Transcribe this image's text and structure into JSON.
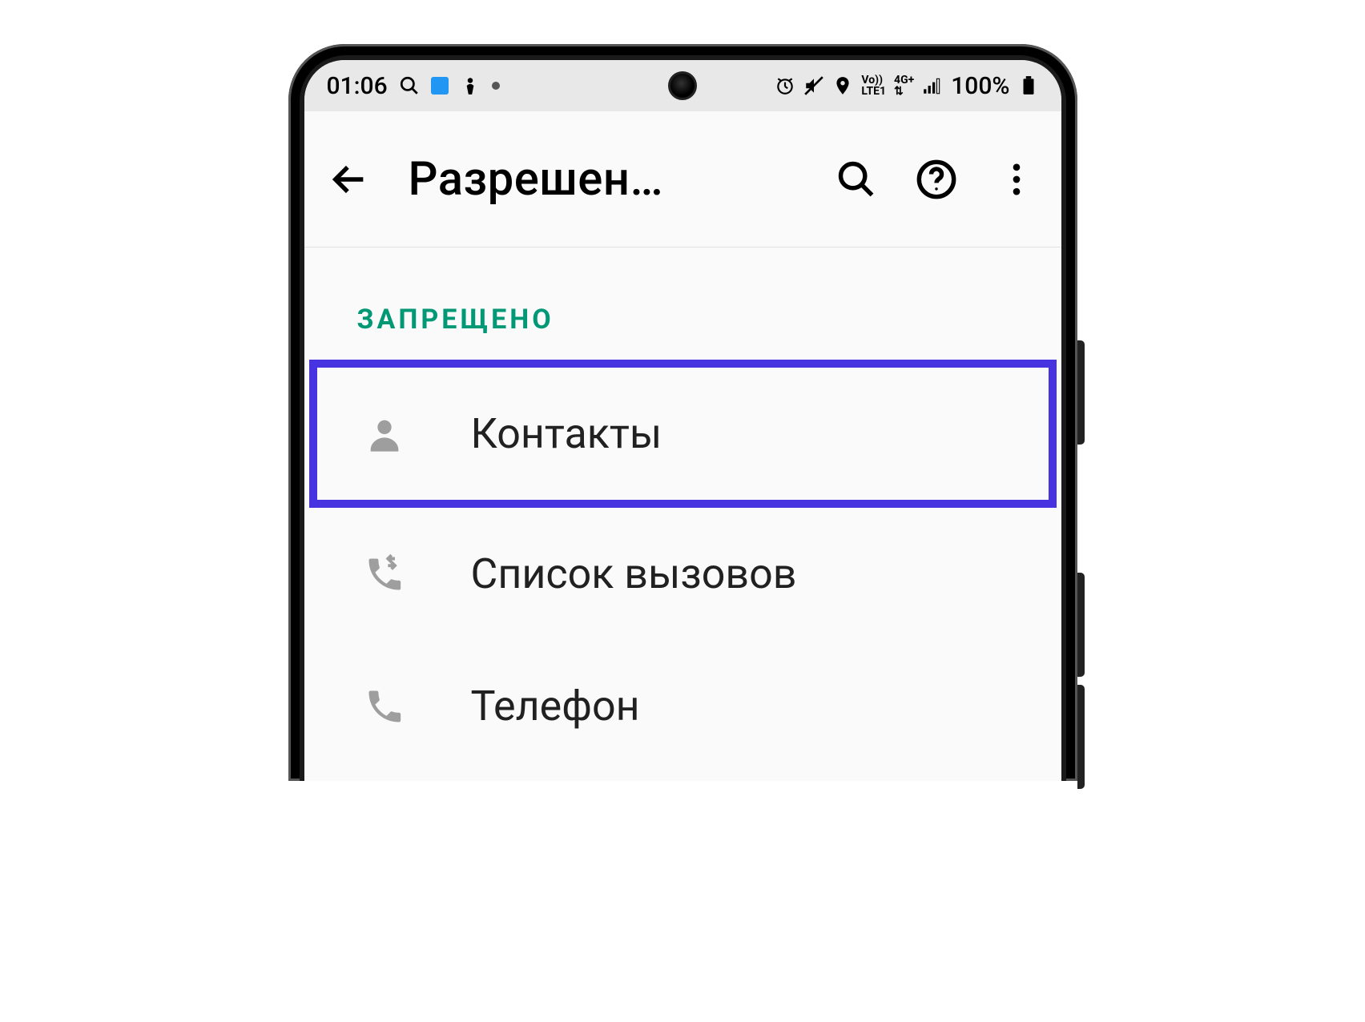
{
  "status_bar": {
    "time": "01:06",
    "battery": "100%"
  },
  "appbar": {
    "title": "Разрешен…"
  },
  "section_header": "ЗАПРЕЩЕНО",
  "permissions": [
    {
      "label": "Контакты",
      "icon": "person-icon",
      "highlight": true
    },
    {
      "label": "Список вызовов",
      "icon": "call-log-icon",
      "highlight": false
    },
    {
      "label": "Телефон",
      "icon": "phone-icon",
      "highlight": false
    }
  ]
}
